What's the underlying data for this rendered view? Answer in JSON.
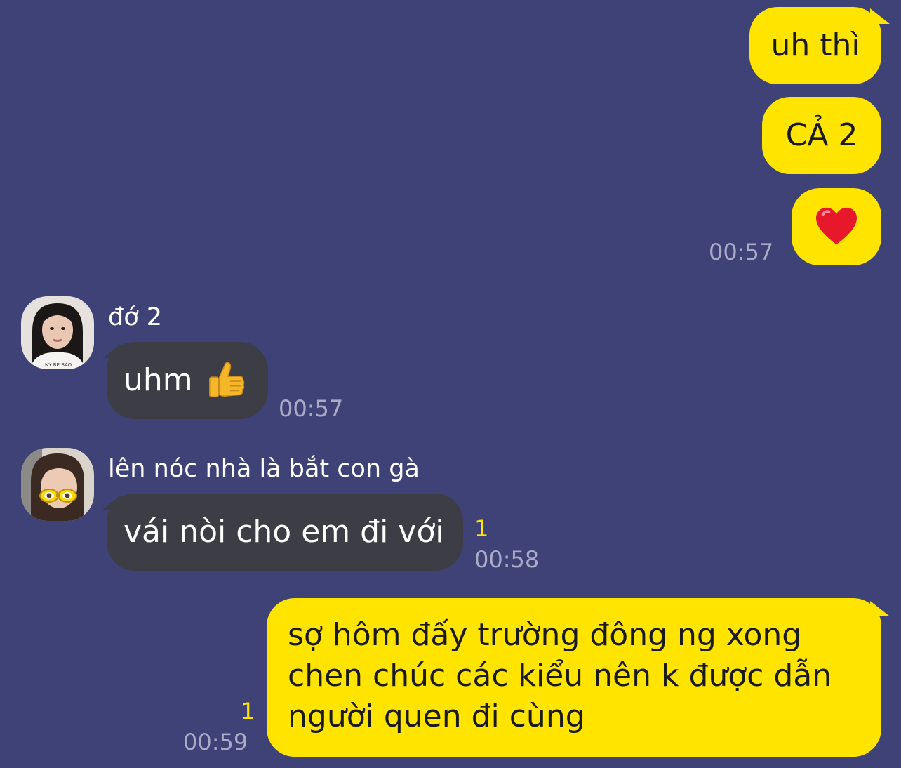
{
  "messages": {
    "m1": {
      "text": "uh thì"
    },
    "m2": {
      "text": "CẢ 2"
    },
    "m3": {
      "emoji": "heart-emoji",
      "time": "00:57"
    },
    "m4": {
      "sender": "đớ 2",
      "text": "uhm",
      "emoji": "thumbs-up-emoji",
      "time": "00:57"
    },
    "m5": {
      "sender": "lên nóc nhà là bắt con gà",
      "text": "vái nòi cho em đi với",
      "unread": "1",
      "time": "00:58"
    },
    "m6": {
      "lines": [
        "sợ hôm đấy trường đông ng xong",
        "chen chúc các kiểu nên k được dẫn",
        "người quen đi cùng"
      ],
      "unread": "1",
      "time": "00:59"
    }
  },
  "colors": {
    "background": "#3f4277",
    "my_bubble": "#ffe400",
    "their_bubble": "#3d3e45",
    "timestamp": "#a8aac6",
    "unread_count": "#ffe400"
  }
}
